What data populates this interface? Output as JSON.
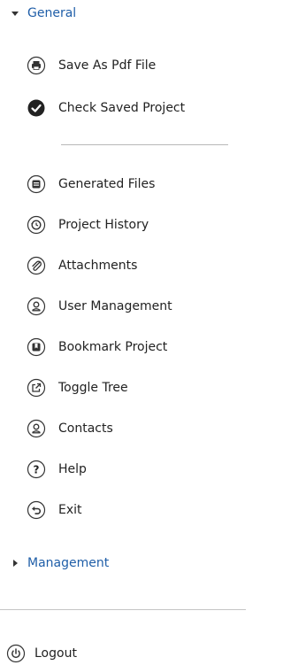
{
  "sections": {
    "general": {
      "label": "General",
      "expanded": true
    },
    "management": {
      "label": "Management",
      "expanded": false
    }
  },
  "menu_top": [
    {
      "label": "Save As Pdf File",
      "icon": "print-icon"
    },
    {
      "label": "Check Saved Project",
      "icon": "check-icon"
    }
  ],
  "menu_main": [
    {
      "label": "Generated Files",
      "icon": "file-icon"
    },
    {
      "label": "Project History",
      "icon": "history-icon"
    },
    {
      "label": "Attachments",
      "icon": "paperclip-icon"
    },
    {
      "label": "User Management",
      "icon": "user-icon"
    },
    {
      "label": "Bookmark Project",
      "icon": "bookmark-icon"
    },
    {
      "label": "Toggle Tree",
      "icon": "external-link-icon"
    },
    {
      "label": "Contacts",
      "icon": "contacts-icon"
    },
    {
      "label": "Help",
      "icon": "help-icon"
    },
    {
      "label": "Exit",
      "icon": "exit-icon"
    }
  ],
  "logout": {
    "label": "Logout",
    "icon": "power-icon"
  },
  "colors": {
    "section_label": "#1f5ea8",
    "icon_stroke": "#333333",
    "divider": "#b8b8b8"
  }
}
